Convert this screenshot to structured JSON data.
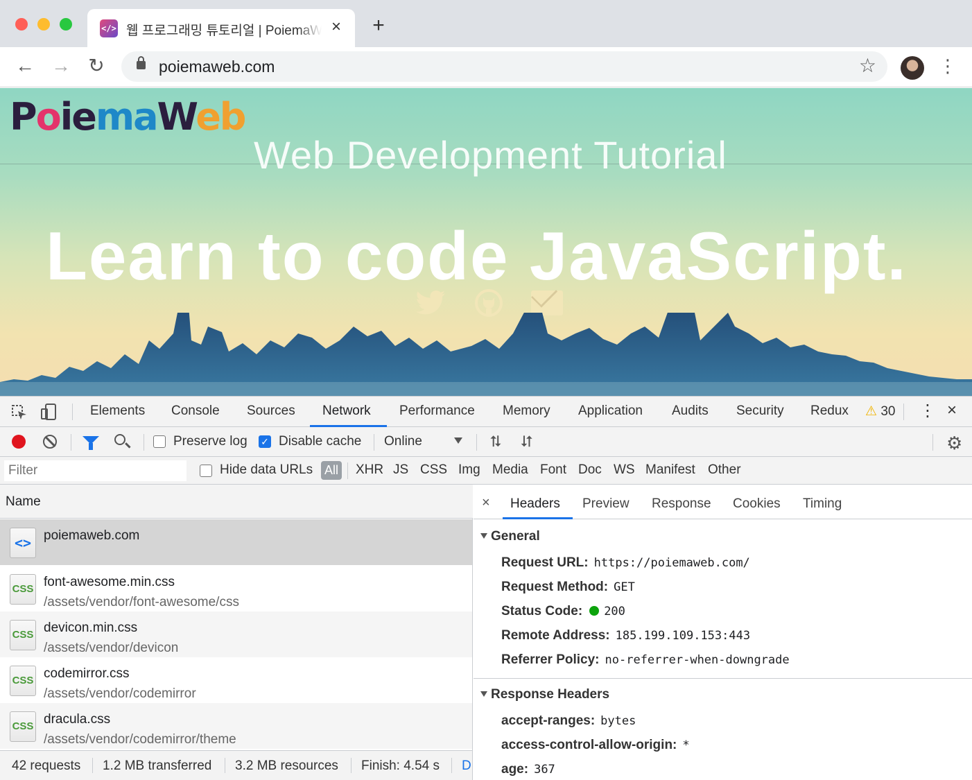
{
  "browser": {
    "tab_title": "웹 프로그래밍 튜토리얼 | PoiemaWeb",
    "url": "poiemaweb.com"
  },
  "page": {
    "logo": "PoiemaWeb",
    "subtitle": "Web Development Tutorial",
    "headline": "Learn to code JavaScript.",
    "social_icons": [
      "twitter-icon",
      "github-icon",
      "mail-icon"
    ]
  },
  "devtools": {
    "tabs": [
      "Elements",
      "Console",
      "Sources",
      "Network",
      "Performance",
      "Memory",
      "Application",
      "Audits",
      "Security",
      "Redux"
    ],
    "selected_tab": "Network",
    "warning_count": "30",
    "controls": {
      "preserve_log": "Preserve log",
      "preserve_log_checked": false,
      "disable_cache": "Disable cache",
      "disable_cache_checked": true,
      "throttle": "Online"
    },
    "filter": {
      "placeholder": "Filter",
      "hide_data_urls": "Hide data URLs",
      "types": [
        "All",
        "XHR",
        "JS",
        "CSS",
        "Img",
        "Media",
        "Font",
        "Doc",
        "WS",
        "Manifest",
        "Other"
      ]
    },
    "list_header": "Name",
    "requests": [
      {
        "name": "poiemaweb.com",
        "path": "",
        "type": "doc"
      },
      {
        "name": "font-awesome.min.css",
        "path": "/assets/vendor/font-awesome/css",
        "type": "css"
      },
      {
        "name": "devicon.min.css",
        "path": "/assets/vendor/devicon",
        "type": "css"
      },
      {
        "name": "codemirror.css",
        "path": "/assets/vendor/codemirror",
        "type": "css"
      },
      {
        "name": "dracula.css",
        "path": "/assets/vendor/codemirror/theme",
        "type": "css"
      }
    ],
    "status": {
      "requests": "42 requests",
      "transferred": "1.2 MB transferred",
      "resources": "3.2 MB resources",
      "finish": "Finish: 4.54 s",
      "more": "D"
    },
    "detail": {
      "close": "×",
      "tabs": [
        "Headers",
        "Preview",
        "Response",
        "Cookies",
        "Timing"
      ],
      "selected_tab": "Headers",
      "general_title": "General",
      "general": [
        {
          "key": "Request URL:",
          "value": "https://poiemaweb.com/"
        },
        {
          "key": "Request Method:",
          "value": "GET"
        },
        {
          "key": "Status Code:",
          "value": "200"
        },
        {
          "key": "Remote Address:",
          "value": "185.199.109.153:443"
        },
        {
          "key": "Referrer Policy:",
          "value": "no-referrer-when-downgrade"
        }
      ],
      "response_title": "Response Headers",
      "response": [
        {
          "key": "accept-ranges:",
          "value": "bytes"
        },
        {
          "key": "access-control-allow-origin:",
          "value": "*"
        },
        {
          "key": "age:",
          "value": "367"
        }
      ],
      "status_color": "#0ca30c"
    }
  }
}
